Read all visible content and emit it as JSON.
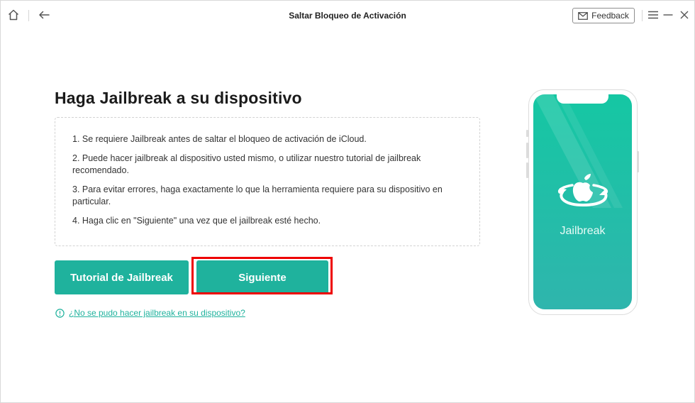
{
  "window": {
    "title": "Saltar Bloqueo de Activación"
  },
  "toolbar": {
    "home_icon": "home-icon",
    "back_icon": "arrow-left-icon",
    "feedback_label": "Feedback",
    "feedback_icon": "envelope-icon",
    "menu_icon": "hamburger-icon",
    "minimize_icon": "minimize-icon",
    "close_icon": "close-icon"
  },
  "main": {
    "heading": "Haga Jailbreak a su dispositivo",
    "instructions": [
      "1. Se requiere Jailbreak antes de saltar el bloqueo de activación de iCloud.",
      "2. Puede hacer jailbreak al dispositivo usted mismo, o utilizar nuestro tutorial de jailbreak recomendado.",
      "3. Para evitar errores, haga exactamente lo que la herramienta requiere para su dispositivo en particular.",
      "4. Haga clic en \"Siguiente\" una vez que el jailbreak esté hecho."
    ],
    "tutorial_button": "Tutorial de Jailbreak",
    "next_button": "Siguiente",
    "help_link": "¿No se pudo hacer jailbreak en su dispositivo?"
  },
  "phone": {
    "label": "Jailbreak"
  },
  "colors": {
    "accent": "#1fb29d",
    "highlight": "#ee0000",
    "phone_top": "#15c7a3",
    "phone_bottom": "#2fb5ad"
  }
}
